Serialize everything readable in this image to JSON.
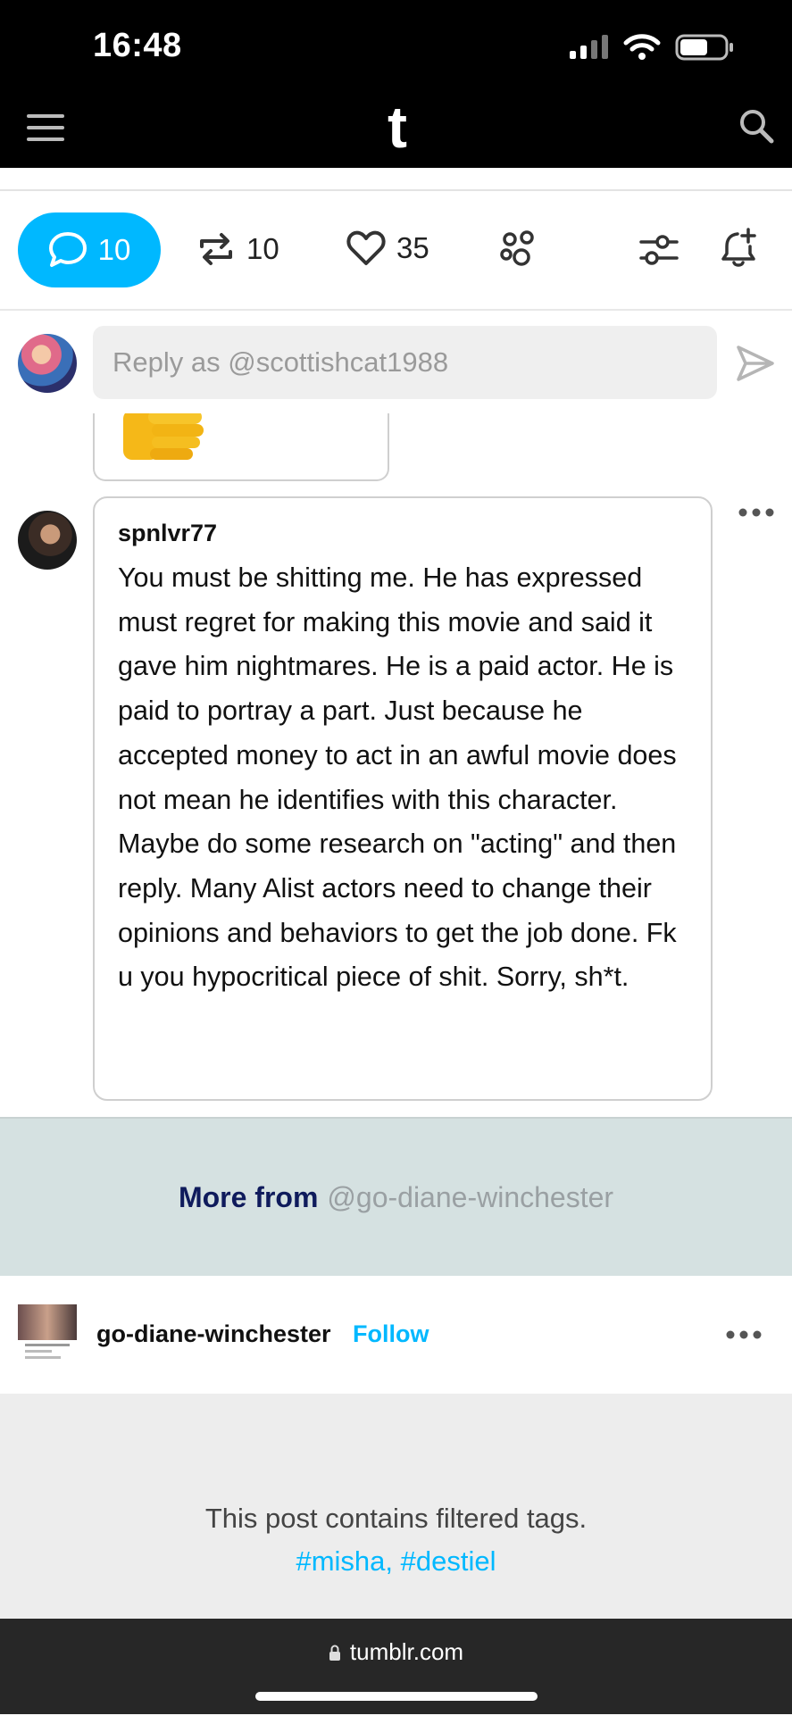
{
  "status_bar": {
    "time": "16:48"
  },
  "header": {
    "logo": "t"
  },
  "actions": {
    "comments": "10",
    "reblogs": "10",
    "likes": "35"
  },
  "reply": {
    "placeholder": "Reply as @scottishcat1988"
  },
  "comment": {
    "username": "spnlvr77",
    "text": "You must be shitting me. He has expressed must regret for making this movie and said it gave him nightmares. He is a paid actor. He is paid to portray a part. Just because he accepted money to act in an awful movie does not mean he identifies with this character. Maybe do some research on \"acting\" and then reply. Many Alist actors need to change their opinions and behaviors to get the job done. Fk u you hypocritical piece of shit. Sorry, sh*t."
  },
  "more_from": {
    "label": "More from",
    "handle": "@go-diane-winchester"
  },
  "post": {
    "blog_name": "go-diane-winchester",
    "follow_label": "Follow"
  },
  "filtered": {
    "message": "This post contains filtered tags.",
    "tags": "#misha, #destiel"
  },
  "browser": {
    "url": "tumblr.com"
  },
  "colors": {
    "accent": "#00b8ff",
    "navy": "#001935",
    "more_from_bg": "#d5e1e1"
  }
}
